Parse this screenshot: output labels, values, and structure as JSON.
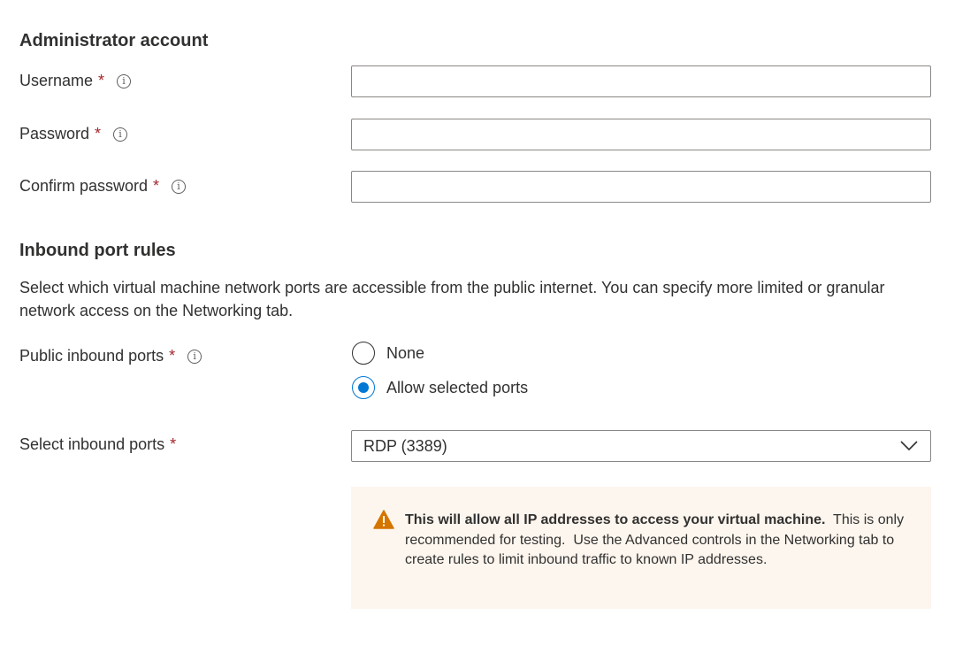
{
  "admin": {
    "heading": "Administrator account",
    "username_label": "Username",
    "password_label": "Password",
    "confirm_label": "Confirm password",
    "required_mark": "*",
    "info_glyph": "i"
  },
  "inbound": {
    "heading": "Inbound port rules",
    "description": "Select which virtual machine network ports are accessible from the public internet. You can specify more limited or granular network access on the Networking tab.",
    "public_ports_label": "Public inbound ports",
    "radio_none": "None",
    "radio_allow": "Allow selected ports",
    "selected_option": "allow",
    "select_ports_label": "Select inbound ports",
    "select_ports_value": "RDP (3389)"
  },
  "warning": {
    "bold": "This will allow all IP addresses to access your virtual machine.",
    "rest": "  This is only recommended for testing.  Use the Advanced controls in the Networking tab to create rules to limit inbound traffic to known IP addresses.",
    "icon": "warning-triangle-icon"
  },
  "colors": {
    "required": "#a4262c",
    "accent": "#0078d4",
    "warning_bg": "#fdf6ee",
    "warning_icon": "#d47500"
  }
}
